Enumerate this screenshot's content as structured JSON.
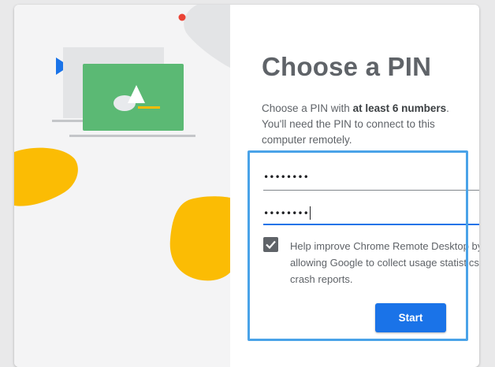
{
  "dialog": {
    "title": "Choose a PIN",
    "description_part1": "Choose a PIN with ",
    "description_bold1": "at least 6",
    "description_bold2": "numbers",
    "description_part2": ". You'll need the PIN to connect to this computer remotely.",
    "pin_value": "••••••••",
    "pin_confirm_value": "••••••••",
    "checkbox_checked": true,
    "checkbox_label": "Help improve Chrome Remote Desktop by allowing Google to collect usage statistics and crash reports.",
    "start_label": "Start"
  },
  "colors": {
    "accent": "#1a73e8",
    "highlight": "#4aa3e8",
    "illustration_green": "#5bb974",
    "illustration_yellow": "#fbbc04",
    "illustration_blue": "#1a73e8",
    "illustration_red": "#ea4335"
  }
}
